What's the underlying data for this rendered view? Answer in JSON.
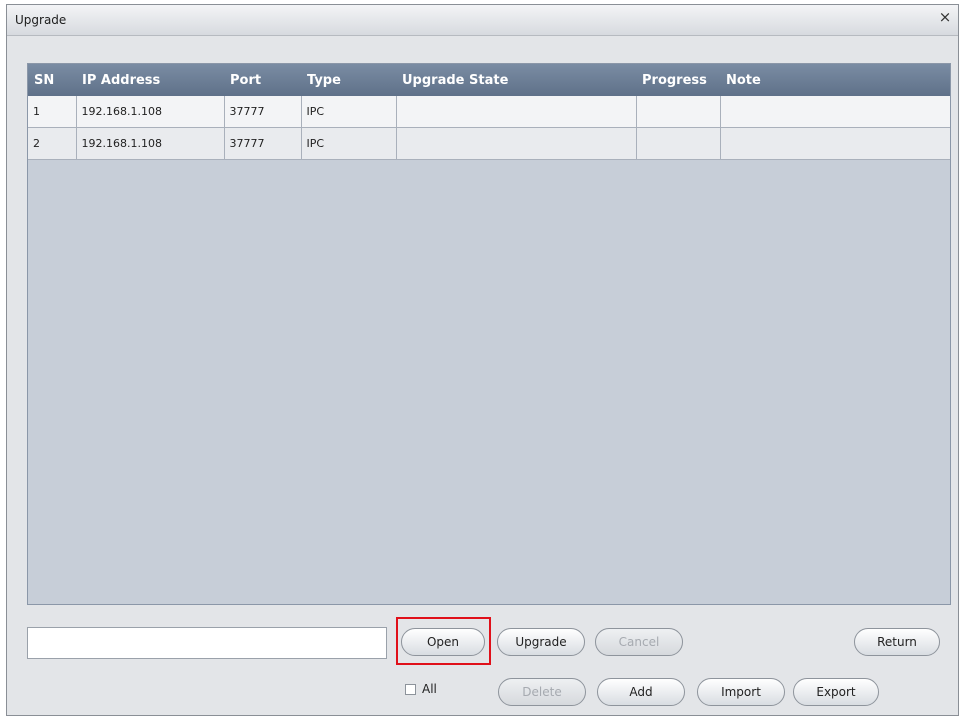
{
  "window": {
    "title": "Upgrade",
    "close_glyph": "×"
  },
  "table": {
    "headers": [
      "SN",
      "IP Address",
      "Port",
      "Type",
      "Upgrade State",
      "Progress",
      "Note"
    ],
    "rows": [
      [
        "1",
        "192.168.1.108",
        "37777",
        "IPC",
        "",
        "",
        ""
      ],
      [
        "2",
        "192.168.1.108",
        "37777",
        "IPC",
        "",
        "",
        ""
      ]
    ]
  },
  "file_path": {
    "value": "",
    "placeholder": ""
  },
  "buttons": {
    "open": "Open",
    "upgrade": "Upgrade",
    "cancel": "Cancel",
    "return": "Return",
    "delete": "Delete",
    "add": "Add",
    "import": "Import",
    "export": "Export"
  },
  "all_checkbox": {
    "label": "All",
    "checked": false
  },
  "colors": {
    "header_bg": "#6a7c94",
    "grid_bg": "#c7ced8",
    "highlight": "#e0101a"
  }
}
